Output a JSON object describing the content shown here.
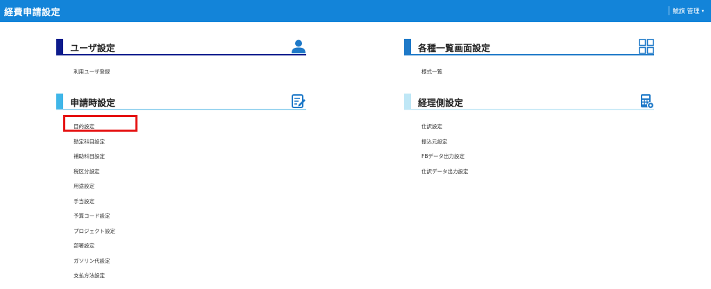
{
  "app": {
    "title": "経費申請設定"
  },
  "user_menu": {
    "label": "鯱旗 管理"
  },
  "colors": {
    "topbar": "#1384d9"
  },
  "sections": [
    {
      "title": "ユーザ設定",
      "icon": "user-icon",
      "accent": "#0d1b8c",
      "underline": "#0d1b8c",
      "items": [
        "利用ユーザ登録"
      ]
    },
    {
      "title": "申請時設定",
      "icon": "edit-document-icon",
      "accent": "#3fb6e8",
      "underline": "#9ed6f0",
      "items": [
        "目的設定",
        "勘定科目設定",
        "補助科目設定",
        "税区分設定",
        "用途設定",
        "手当設定",
        "予算コード設定",
        "プロジェクト設定",
        "部署設定",
        "ガソリン代設定",
        "支払方法設定"
      ]
    },
    {
      "title": "各種一覧画面設定",
      "icon": "grid-icon",
      "accent": "#1e79c8",
      "underline": "#1e79c8",
      "items": [
        "様式一覧"
      ]
    },
    {
      "title": "経理側設定",
      "icon": "calculator-icon",
      "accent": "#bfe7f6",
      "underline": "#cdebf7",
      "items": [
        "仕訳設定",
        "振込元設定",
        "FBデータ出力設定",
        "仕訳データ出力設定"
      ]
    }
  ]
}
